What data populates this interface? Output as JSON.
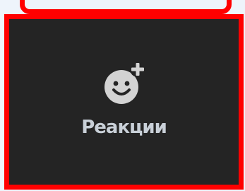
{
  "toolbar_button": {
    "label": "Реакции",
    "icon": "add-reaction-icon"
  },
  "colors": {
    "highlight_border": "#ff0000",
    "button_background": "#242424",
    "icon_fill": "#d3d3d3",
    "label_color": "#c9d0d8"
  }
}
